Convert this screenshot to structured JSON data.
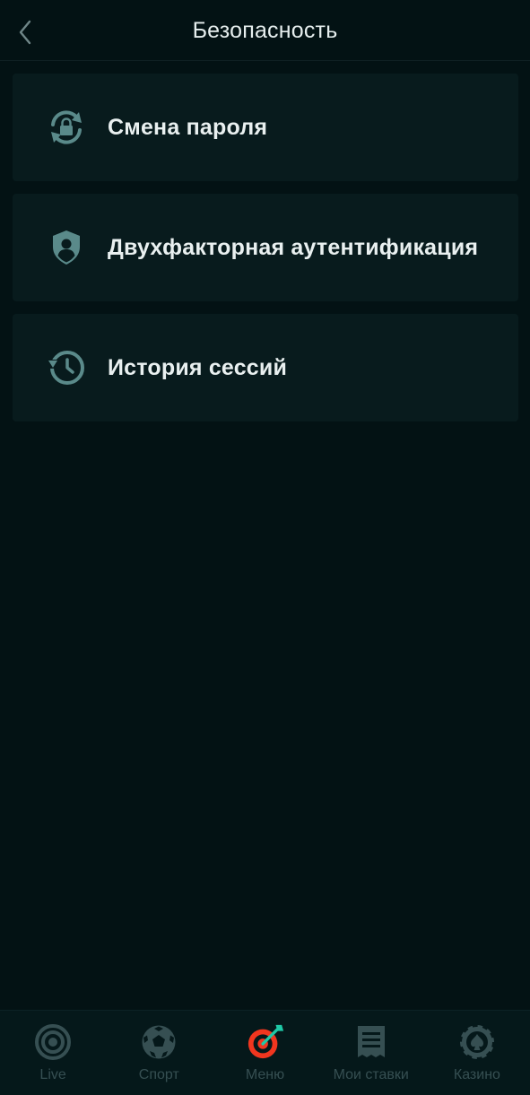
{
  "header": {
    "title": "Безопасность",
    "back_icon": "chevron-left-icon"
  },
  "menu": {
    "items": [
      {
        "label": "Смена пароля",
        "icon": "lock-refresh-icon"
      },
      {
        "label": "Двухфакторная аутентификация",
        "icon": "shield-user-icon"
      },
      {
        "label": "История сессий",
        "icon": "history-clock-icon"
      }
    ]
  },
  "bottom_nav": {
    "items": [
      {
        "label": "Live",
        "icon": "live-target-icon"
      },
      {
        "label": "Спорт",
        "icon": "soccer-ball-icon"
      },
      {
        "label": "Меню",
        "icon": "dart-target-icon",
        "active": true
      },
      {
        "label": "Мои ставки",
        "icon": "receipt-icon"
      },
      {
        "label": "Казино",
        "icon": "casino-chip-icon"
      }
    ]
  },
  "colors": {
    "background": "#031214",
    "card": "#081b1d",
    "icon": "#5a8a8a",
    "nav_inactive": "#364f52",
    "accent_red": "#f0361f",
    "accent_green": "#1fc8a6"
  }
}
